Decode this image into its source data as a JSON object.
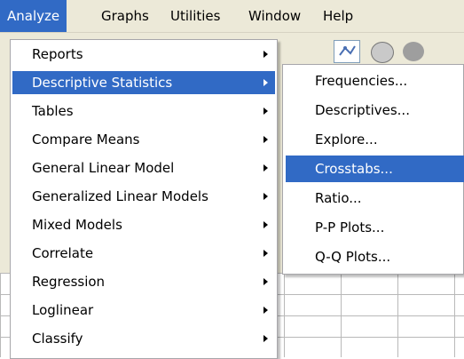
{
  "menubar": {
    "items": [
      {
        "label": "Analyze"
      },
      {
        "label": "Graphs"
      },
      {
        "label": "Utilities"
      },
      {
        "label": "Window"
      },
      {
        "label": "Help"
      }
    ]
  },
  "analyze_menu": {
    "items": [
      {
        "label": "Reports"
      },
      {
        "label": "Descriptive Statistics"
      },
      {
        "label": "Tables"
      },
      {
        "label": "Compare Means"
      },
      {
        "label": "General Linear Model"
      },
      {
        "label": "Generalized Linear Models"
      },
      {
        "label": "Mixed Models"
      },
      {
        "label": "Correlate"
      },
      {
        "label": "Regression"
      },
      {
        "label": "Loglinear"
      },
      {
        "label": "Classify"
      }
    ]
  },
  "descriptive_submenu": {
    "items": [
      {
        "label": "Frequencies..."
      },
      {
        "label": "Descriptives..."
      },
      {
        "label": "Explore..."
      },
      {
        "label": "Crosstabs..."
      },
      {
        "label": "Ratio..."
      },
      {
        "label": "P-P Plots..."
      },
      {
        "label": "Q-Q Plots..."
      }
    ]
  },
  "colors": {
    "highlight": "#316ac5",
    "menubar_bg": "#ece9d8",
    "menu_bg": "#ffffff"
  }
}
